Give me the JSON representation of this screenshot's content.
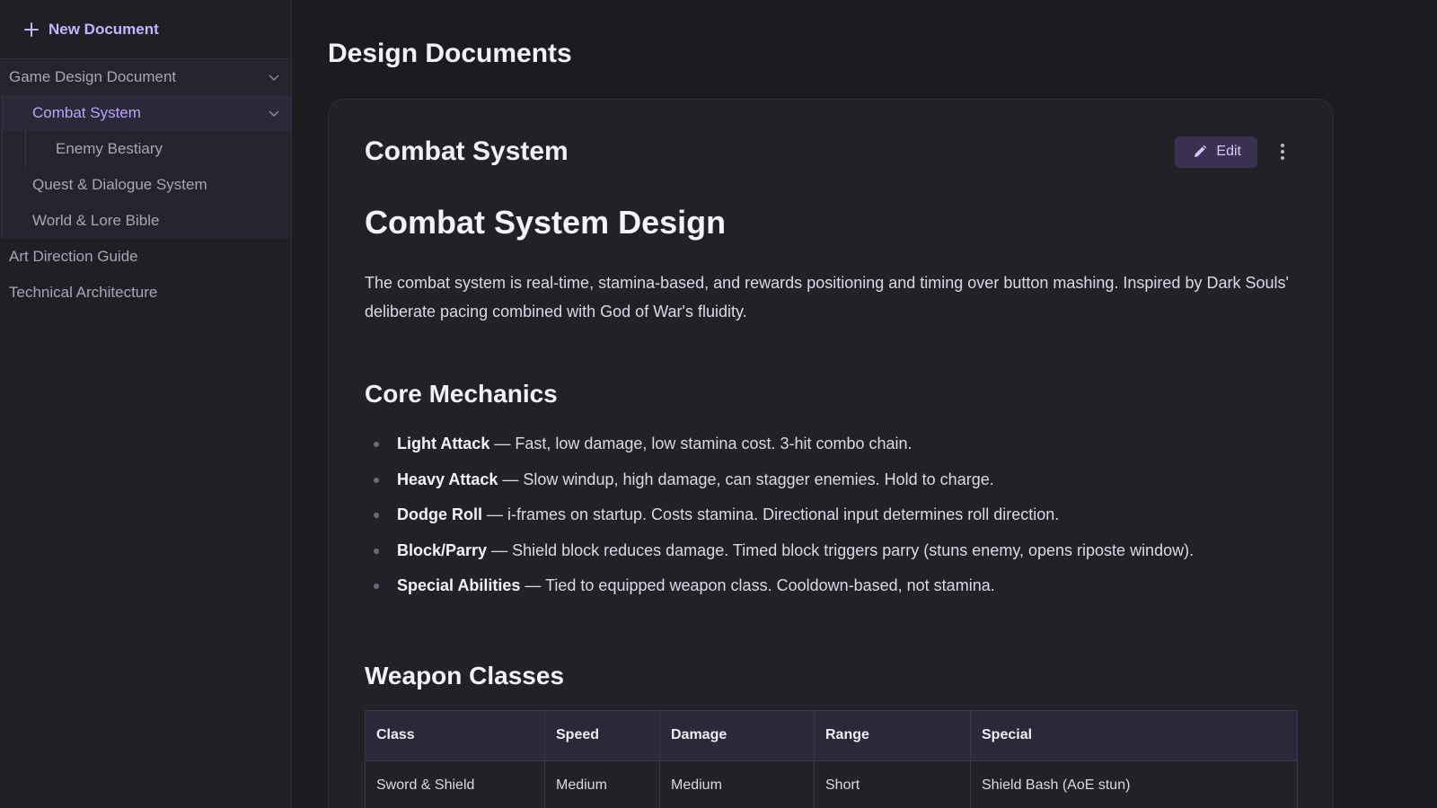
{
  "sidebar": {
    "new_document_label": "New Document",
    "items": [
      {
        "label": "Game Design Document"
      },
      {
        "label": "Combat System"
      },
      {
        "label": "Enemy Bestiary"
      },
      {
        "label": "Quest & Dialogue System"
      },
      {
        "label": "World & Lore Bible"
      },
      {
        "label": "Art Direction Guide"
      },
      {
        "label": "Technical Architecture"
      }
    ]
  },
  "main": {
    "page_title": "Design Documents",
    "card": {
      "title": "Combat System",
      "edit_label": "Edit"
    },
    "doc": {
      "h1": "Combat System Design",
      "intro": "The combat system is real-time, stamina-based, and rewards positioning and timing over button mashing. Inspired by Dark Souls' deliberate pacing combined with God of War's fluidity.",
      "core_heading": "Core Mechanics",
      "mechanics": [
        {
          "term": "Light Attack",
          "desc": " — Fast, low damage, low stamina cost. 3-hit combo chain."
        },
        {
          "term": "Heavy Attack",
          "desc": " — Slow windup, high damage, can stagger enemies. Hold to charge."
        },
        {
          "term": "Dodge Roll",
          "desc": " — i-frames on startup. Costs stamina. Directional input determines roll direction."
        },
        {
          "term": "Block/Parry",
          "desc": " — Shield block reduces damage. Timed block triggers parry (stuns enemy, opens riposte window)."
        },
        {
          "term": "Special Abilities",
          "desc": " — Tied to equipped weapon class. Cooldown-based, not stamina."
        }
      ],
      "weapons_heading": "Weapon Classes",
      "table": {
        "headers": [
          "Class",
          "Speed",
          "Damage",
          "Range",
          "Special"
        ],
        "rows": [
          [
            "Sword & Shield",
            "Medium",
            "Medium",
            "Short",
            "Shield Bash (AoE stun)"
          ]
        ]
      }
    }
  },
  "colors": {
    "accent": "#c4b5fd",
    "background": "#1c1b20",
    "sidebar_bg": "#211f26",
    "card_bg": "#222127"
  },
  "icons": [
    "plus-icon",
    "chevron-down-icon",
    "pencil-icon",
    "more-vertical-icon"
  ]
}
